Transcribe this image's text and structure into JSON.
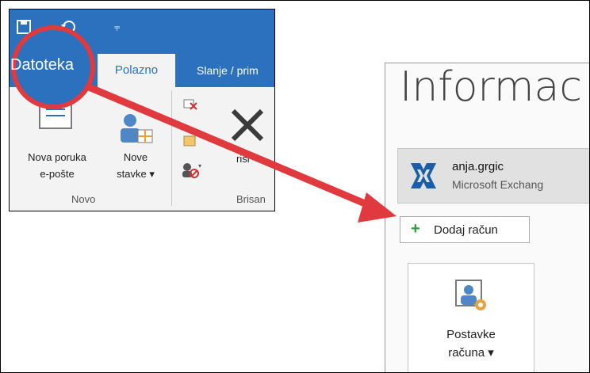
{
  "ribbon": {
    "qat_dropdown_glyph": "⫧",
    "tabs": {
      "file": "Datoteka",
      "home": "Polazno",
      "send": "Slanje / prim"
    },
    "buttons": {
      "new_email": [
        "Nova poruka",
        "e-pošte"
      ],
      "new_items": [
        "Nove",
        "stavke ▾"
      ],
      "delete_partial": "riši"
    },
    "groups": {
      "new": "Novo",
      "delete": "Brisan"
    }
  },
  "backstage": {
    "title": "Informac",
    "account": {
      "name": "anja.grgic",
      "type": "Microsoft Exchang"
    },
    "add_account": {
      "icon": "+",
      "label": "Dodaj račun"
    },
    "account_settings": [
      "Postavke",
      "računa ▾"
    ]
  },
  "colors": {
    "ribbon_blue": "#2b71be",
    "annotation_red": "#e03a3e",
    "exchange_blue": "#1b5ea8",
    "plus_green": "#2f9b3f"
  }
}
